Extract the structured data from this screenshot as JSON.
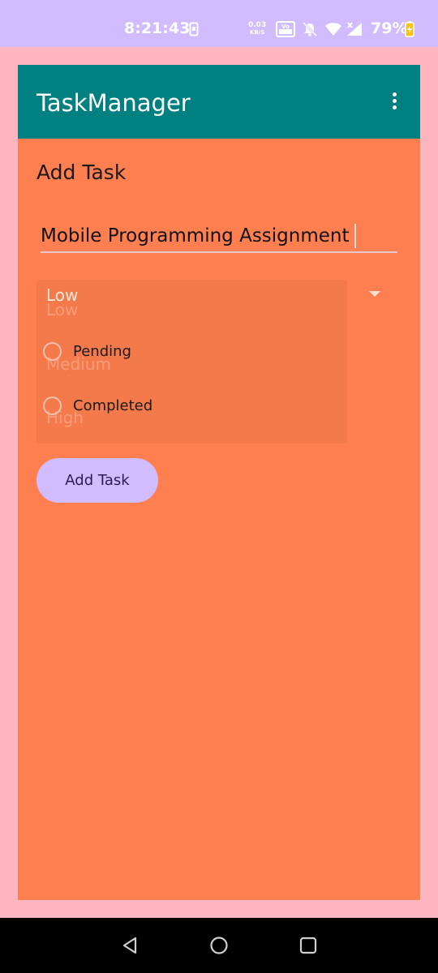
{
  "status_bar": {
    "time": "8:21:43",
    "network_speed_value": "0.03",
    "network_speed_unit": "KB/S",
    "volte_label": "Vo WiFi",
    "battery_percent": "79%",
    "icons": [
      "screenshot-icon",
      "volte-wifi-icon",
      "mute-notifications-icon",
      "wifi-icon",
      "signal-icon",
      "battery-charging-icon"
    ]
  },
  "app_bar": {
    "title": "TaskManager",
    "overflow_icon": "more-vert-icon"
  },
  "form": {
    "heading": "Add Task",
    "task_input": {
      "value": "Mobile Programming Assignment",
      "placeholder": ""
    },
    "priority": {
      "selected": "Low",
      "options": [
        "Low",
        "Medium",
        "High"
      ]
    },
    "status_options": [
      {
        "label": "Pending",
        "checked": false
      },
      {
        "label": "Completed",
        "checked": false
      }
    ],
    "submit_label": "Add Task"
  },
  "nav_bar": {
    "icons": [
      "back-icon",
      "home-icon",
      "recents-icon"
    ]
  },
  "colors": {
    "status_bar": "#D0BCFF",
    "app_bar": "#008080",
    "content_bg": "#FF7F50",
    "window_bg": "#FFB6C1",
    "button_bg": "#D0BCFF"
  }
}
